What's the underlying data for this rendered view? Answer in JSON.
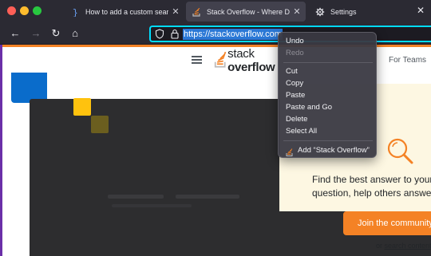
{
  "browser": {
    "tabs": [
      {
        "title": "How to add a custom search engine",
        "favicon": "code-brackets-icon",
        "close": "✕"
      },
      {
        "title": "Stack Overflow - Where Developers",
        "favicon": "stackoverflow-icon",
        "close": "✕"
      },
      {
        "title": "Settings",
        "favicon": "gear-icon",
        "close": ""
      }
    ],
    "window_close": "✕",
    "nav": {
      "back": "←",
      "forward": "→",
      "reload": "↻",
      "home": "⌂"
    },
    "url": "https://stackoverflow.com"
  },
  "context_menu": {
    "undo": "Undo",
    "redo": "Redo",
    "cut": "Cut",
    "copy": "Copy",
    "paste": "Paste",
    "paste_and_go": "Paste and Go",
    "delete": "Delete",
    "select_all": "Select All",
    "add_search": "Add “Stack Overflow”"
  },
  "page": {
    "logo_text_light": "stack ",
    "logo_text_bold": "overflow",
    "for_teams": "For Teams",
    "promo_line1": "Find the best answer to your",
    "promo_line2": "question, help others answer",
    "join_button": "Join the community",
    "or_text": "or ",
    "search_link": "search content"
  },
  "colors": {
    "so_orange": "#f48225",
    "focus_ring": "#00ddff",
    "selection": "#2a78d6"
  }
}
